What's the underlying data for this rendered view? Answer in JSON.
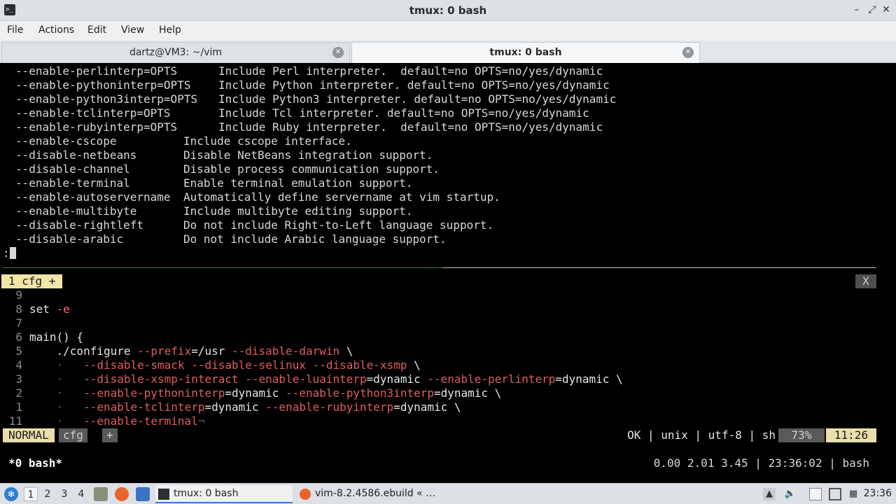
{
  "window": {
    "title": "tmux: 0 bash",
    "app_icon": "terminal-icon",
    "controls": [
      "minimize-icon",
      "maximize-icon",
      "close-icon"
    ]
  },
  "menu": [
    "File",
    "Actions",
    "Edit",
    "View",
    "Help"
  ],
  "tabs": [
    {
      "label": "dartz@VM3: ~/vim",
      "active": false
    },
    {
      "label": "tmux: 0 bash",
      "active": true
    }
  ],
  "help_lines": [
    {
      "opt": "--enable-perlinterp=OPTS",
      "desc": "Include Perl interpreter.  default=no OPTS=no/yes/dynamic"
    },
    {
      "opt": "--enable-pythoninterp=OPTS",
      "desc": "Include Python interpreter. default=no OPTS=no/yes/dynamic"
    },
    {
      "opt": "--enable-python3interp=OPTS",
      "desc": "Include Python3 interpreter. default=no OPTS=no/yes/dynamic"
    },
    {
      "opt": "--enable-tclinterp=OPTS",
      "desc": "Include Tcl interpreter. default=no OPTS=no/yes/dynamic"
    },
    {
      "opt": "--enable-rubyinterp=OPTS",
      "desc": "Include Ruby interpreter.  default=no OPTS=no/yes/dynamic"
    },
    {
      "opt": "--enable-cscope",
      "desc": "Include cscope interface."
    },
    {
      "opt": "--disable-netbeans",
      "desc": "Disable NetBeans integration support."
    },
    {
      "opt": "--disable-channel",
      "desc": "Disable process communication support."
    },
    {
      "opt": "--enable-terminal",
      "desc": "Enable terminal emulation support."
    },
    {
      "opt": "--enable-autoservername",
      "desc": "Automatically define servername at vim startup."
    },
    {
      "opt": "--enable-multibyte",
      "desc": "Include multibyte editing support."
    },
    {
      "opt": "--disable-rightleft",
      "desc": "Do not include Right-to-Left language support."
    },
    {
      "opt": "--disable-arabic",
      "desc": "Do not include Arabic language support."
    }
  ],
  "prompt": ":",
  "vim_tabline": {
    "tab": "1 cfg +",
    "close": "X"
  },
  "code_lines": [
    {
      "ln": "9",
      "segs": []
    },
    {
      "ln": "8",
      "segs": [
        {
          "t": "set ",
          "c": "plain"
        },
        {
          "t": "-e",
          "c": "kw"
        }
      ]
    },
    {
      "ln": "7",
      "segs": []
    },
    {
      "ln": "6",
      "segs": [
        {
          "t": "main() {",
          "c": "plain"
        }
      ]
    },
    {
      "ln": "5",
      "segs": [
        {
          "t": "    ./configure ",
          "c": "plain"
        },
        {
          "t": "--prefix",
          "c": "fl"
        },
        {
          "t": "=/usr ",
          "c": "plain"
        },
        {
          "t": "--disable-darwin",
          "c": "fl"
        },
        {
          "t": " \\",
          "c": "plain"
        }
      ]
    },
    {
      "ln": "4",
      "segs": [
        {
          "t": "    ·   ",
          "c": "dot"
        },
        {
          "t": "--disable-smack",
          "c": "fl"
        },
        {
          "t": " ",
          "c": "plain"
        },
        {
          "t": "--disable-selinux",
          "c": "fl"
        },
        {
          "t": " ",
          "c": "plain"
        },
        {
          "t": "--disable-xsmp",
          "c": "fl"
        },
        {
          "t": " \\",
          "c": "plain"
        }
      ]
    },
    {
      "ln": "3",
      "segs": [
        {
          "t": "    ·   ",
          "c": "dot"
        },
        {
          "t": "--disable-xsmp-interact",
          "c": "fl"
        },
        {
          "t": " ",
          "c": "plain"
        },
        {
          "t": "--enable-luainterp",
          "c": "fl"
        },
        {
          "t": "=dynamic ",
          "c": "plain"
        },
        {
          "t": "--enable-perlinterp",
          "c": "fl"
        },
        {
          "t": "=dynamic \\",
          "c": "plain"
        }
      ]
    },
    {
      "ln": "2",
      "segs": [
        {
          "t": "    ·   ",
          "c": "dot"
        },
        {
          "t": "--enable-pythoninterp",
          "c": "fl"
        },
        {
          "t": "=dynamic ",
          "c": "plain"
        },
        {
          "t": "--enable-python3interp",
          "c": "fl"
        },
        {
          "t": "=dynamic \\",
          "c": "plain"
        }
      ]
    },
    {
      "ln": "1",
      "segs": [
        {
          "t": "    ·   ",
          "c": "dot"
        },
        {
          "t": "--enable-tclinterp",
          "c": "fl"
        },
        {
          "t": "=dynamic ",
          "c": "plain"
        },
        {
          "t": "--enable-rubyinterp",
          "c": "fl"
        },
        {
          "t": "=dynamic \\",
          "c": "plain"
        }
      ]
    },
    {
      "ln": "11",
      "segs": [
        {
          "t": "    ·   ",
          "c": "dot"
        },
        {
          "t": "--enable-terminal",
          "c": "fl"
        },
        {
          "t": "¬",
          "c": "dot"
        }
      ]
    }
  ],
  "statusline": {
    "mode": "NORMAL",
    "file": "cfg",
    "modified": "+",
    "right": "OK | unix | utf-8 | sh",
    "percent": "73%",
    "position": "11:26"
  },
  "tmux": {
    "left": "*0 bash*",
    "right": "0.00 2.01 3.45 | 23:36:02 | bash"
  },
  "taskbar": {
    "workspaces": [
      "1",
      "2",
      "3",
      "4"
    ],
    "active_workspace": "1",
    "launchers": [
      "file-manager-icon",
      "firefox-icon",
      "desktop-icon"
    ],
    "tasks": [
      {
        "label": "tmux: 0 bash",
        "icon": "terminal-icon",
        "active": true
      },
      {
        "label": "vim-8.2.4586.ebuild « …",
        "icon": "firefox-icon",
        "active": false
      }
    ],
    "tray": [
      "tray-arrow-icon",
      "volume-icon",
      "clipboard-icon",
      "display-icon",
      "network-icon"
    ],
    "clock": "23:36"
  },
  "colors": {
    "flag": "#e05d5d",
    "mode_bg": "#e9dfad",
    "separator_active": "#1e8a3a"
  }
}
